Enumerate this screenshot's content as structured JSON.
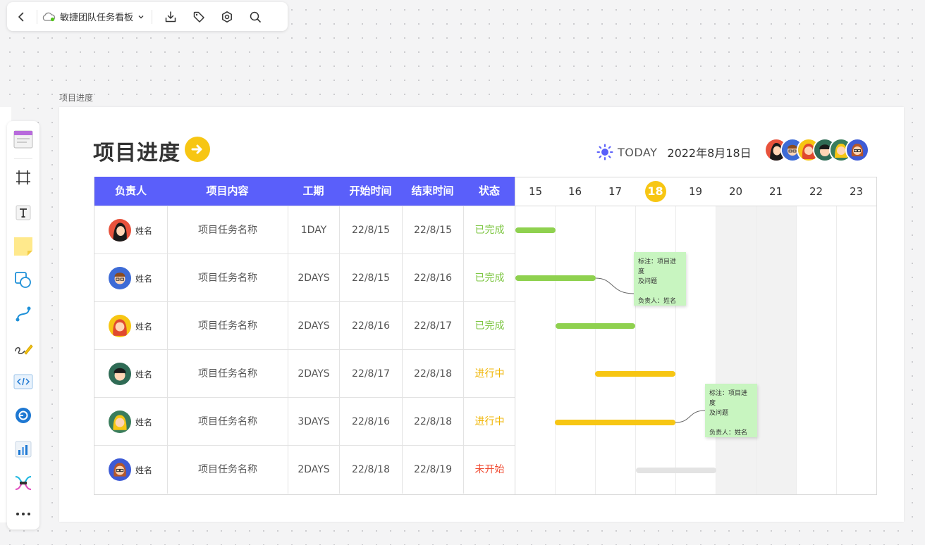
{
  "topbar": {
    "board_title": "敏捷团队任务看板",
    "icons": [
      "back-icon",
      "cloud-sync-icon",
      "chevron-down-icon",
      "download-icon",
      "tag-icon",
      "settings-icon",
      "search-icon"
    ]
  },
  "frame": {
    "label": "项目进度"
  },
  "header": {
    "title": "项目进度",
    "today_label": "TODAY",
    "today_date": "2022年8月18日"
  },
  "table": {
    "columns": [
      "负责人",
      "项目内容",
      "工期",
      "开始时间",
      "结束时间",
      "状态"
    ],
    "rows": [
      {
        "owner": "姓名",
        "task": "项目任务名称",
        "duration": "1DAY",
        "start": "22/8/15",
        "end": "22/8/15",
        "status": "已完成"
      },
      {
        "owner": "姓名",
        "task": "项目任务名称",
        "duration": "2DAYS",
        "start": "22/8/15",
        "end": "22/8/16",
        "status": "已完成"
      },
      {
        "owner": "姓名",
        "task": "项目任务名称",
        "duration": "2DAYS",
        "start": "22/8/16",
        "end": "22/8/17",
        "status": "已完成"
      },
      {
        "owner": "姓名",
        "task": "项目任务名称",
        "duration": "2DAYS",
        "start": "22/8/17",
        "end": "22/8/18",
        "status": "进行中"
      },
      {
        "owner": "姓名",
        "task": "项目任务名称",
        "duration": "3DAYS",
        "start": "22/8/16",
        "end": "22/8/18",
        "status": "进行中"
      },
      {
        "owner": "姓名",
        "task": "项目任务名称",
        "duration": "2DAYS",
        "start": "22/8/18",
        "end": "22/8/19",
        "status": "未开始"
      }
    ]
  },
  "gantt": {
    "days": [
      "15",
      "16",
      "17",
      "18",
      "19",
      "20",
      "21",
      "22",
      "23"
    ],
    "today": "18"
  },
  "notes": [
    {
      "line1": "标注：项目进度",
      "line2": "及问题",
      "line3": "负责人：姓名"
    },
    {
      "line1": "标注：项目进度",
      "line2": "及问题",
      "line3": "负责人：姓名"
    }
  ],
  "colors": {
    "header_blue": "#5a5ffa",
    "done": "#7dc642",
    "in_progress": "#f0b400",
    "not_started": "#f04b32",
    "bar_done": "#8fd14f",
    "bar_progress": "#f7c613",
    "bar_todo": "#e3e3e3",
    "today": "#f7c613",
    "sticky": "#c8f5c0"
  }
}
